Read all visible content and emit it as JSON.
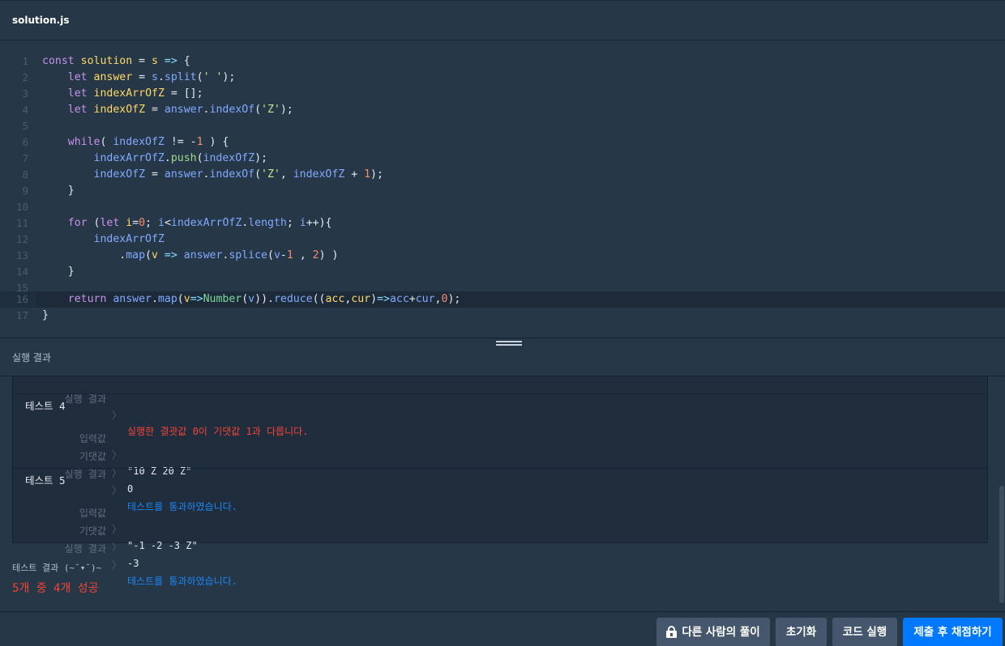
{
  "file_tab": "solution.js",
  "code": {
    "line_numbers": [
      "1",
      "2",
      "3",
      "4",
      "5",
      "6",
      "7",
      "8",
      "9",
      "10",
      "11",
      "12",
      "13",
      "14",
      "15",
      "16",
      "17"
    ]
  },
  "panel_title": "실행 결과",
  "top_partial": {
    "label": "실행 결과",
    "sep": "〉",
    "value": "실행한 결괏값 0이 기댓값 1과 다릅니다."
  },
  "tests": [
    {
      "title": "테스트 4",
      "input_label": "입력값",
      "input": "\"10 Z 20 Z\"",
      "expected_label": "기댓값",
      "expected": "0",
      "result_label": "실행 결과",
      "result": "테스트를 통과하였습니다."
    },
    {
      "title": "테스트 5",
      "input_label": "입력값",
      "input": "\"-1 -2 -3 Z\"",
      "expected_label": "기댓값",
      "expected": "-3",
      "result_label": "실행 결과",
      "result": "테스트를 통과하였습니다."
    }
  ],
  "sep": "〉",
  "summary": {
    "title": "테스트 결과 (~˘▾˘)~",
    "value": "5개 중 4개 성공"
  },
  "buttons": {
    "others_solution": "다른 사람의 풀이",
    "reset": "초기화",
    "run": "코드 실행",
    "submit": "제출 후 채점하기"
  },
  "colors": {
    "error": "#f44336",
    "success": "#1c86f2",
    "primary": "#0078ff"
  }
}
